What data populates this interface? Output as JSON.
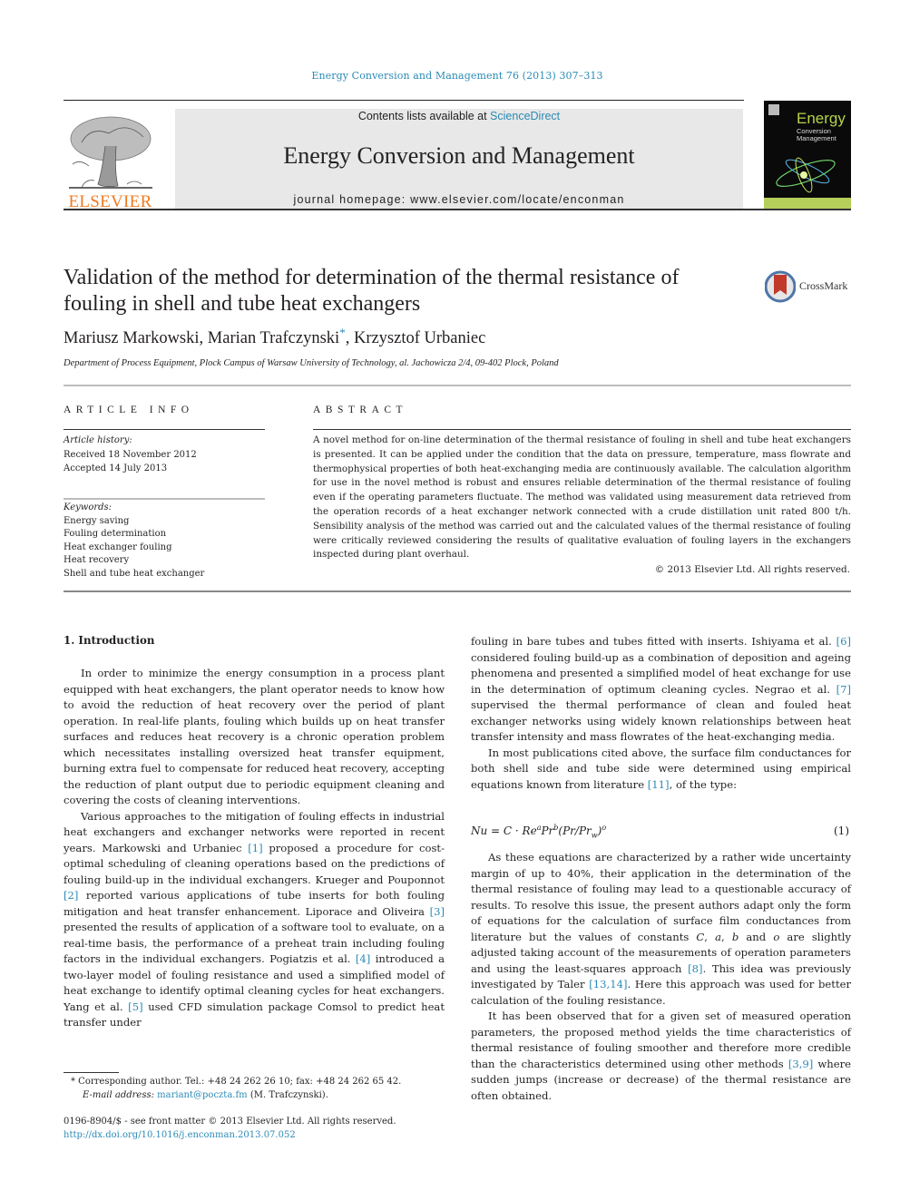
{
  "header": {
    "journal_reference": "Energy Conversion and Management 76 (2013) 307–313",
    "contents_prefix": "Contents lists available at ",
    "contents_link": "ScienceDirect",
    "journal_title": "Energy Conversion and Management",
    "homepage_prefix": "journal homepage: ",
    "homepage_url": "www.elsevier.com/locate/enconman",
    "publisher_logo_text": "ELSEVIER",
    "cover": {
      "title": "Energy",
      "subtitle_line1": "Conversion",
      "subtitle_line2": "Management"
    },
    "colors": {
      "link": "#2a8ab5",
      "elsevier_orange": "#f07b22",
      "masthead_bg": "#e8e8e8"
    }
  },
  "article": {
    "title": "Validation of the method for determination of the thermal resistance of fouling in shell and tube heat exchangers",
    "crossmark_label": "CrossMark",
    "authors": [
      {
        "name": "Mariusz Markowski",
        "corresponding": false
      },
      {
        "name": "Marian Trafczynski",
        "corresponding": true
      },
      {
        "name": "Krzysztof Urbaniec",
        "corresponding": false
      }
    ],
    "author_sep": ", ",
    "corresponding_mark": "*",
    "affiliation": "Department of Process Equipment, Plock Campus of Warsaw University of Technology, al. Jachowicza 2/4, 09-402 Plock, Poland"
  },
  "article_info": {
    "heading": "ARTICLE INFO",
    "history_label": "Article history:",
    "received": "Received 18 November 2012",
    "accepted": "Accepted 14 July 2013",
    "keywords_label": "Keywords:",
    "keywords": [
      "Energy saving",
      "Fouling determination",
      "Heat exchanger fouling",
      "Heat recovery",
      "Shell and tube heat exchanger"
    ]
  },
  "abstract": {
    "heading": "ABSTRACT",
    "text": "A novel method for on-line determination of the thermal resistance of fouling in shell and tube heat exchangers is presented. It can be applied under the condition that the data on pressure, temperature, mass flowrate and thermophysical properties of both heat-exchanging media are continuously available. The calculation algorithm for use in the novel method is robust and ensures reliable determination of the thermal resistance of fouling even if the operating parameters fluctuate. The method was validated using measurement data retrieved from the operation records of a heat exchanger network connected with a crude distillation unit rated 800 t/h. Sensibility analysis of the method was carried out and the calculated values of the thermal resistance of fouling were critically reviewed considering the results of qualitative evaluation of fouling layers in the exchangers inspected during plant overhaul.",
    "copyright": "© 2013 Elsevier Ltd. All rights reserved."
  },
  "body": {
    "section_heading": "1. Introduction",
    "left_paragraphs": [
      [
        {
          "t": "In order to minimize the energy consumption in a process plant equipped with heat exchangers, the plant operator needs to know how to avoid the reduction of heat recovery over the period of plant operation. In real-life plants, fouling which builds up on heat transfer surfaces and reduces heat recovery is a chronic operation problem which necessitates installing oversized heat transfer equipment, burning extra fuel to compensate for reduced heat recovery, accepting the reduction of plant output due to periodic equipment cleaning and covering the costs of cleaning interventions."
        }
      ],
      [
        {
          "t": "Various approaches to the mitigation of fouling effects in industrial heat exchangers and exchanger networks were reported in recent years. Markowski and Urbaniec "
        },
        {
          "ref": "[1]"
        },
        {
          "t": " proposed a procedure for cost-optimal scheduling of cleaning operations based on the predictions of fouling build-up in the individual exchangers. Krueger and Pouponnot "
        },
        {
          "ref": "[2]"
        },
        {
          "t": " reported various applications of tube inserts for both fouling mitigation and heat transfer enhancement. Liporace and Oliveira "
        },
        {
          "ref": "[3]"
        },
        {
          "t": " presented the results of application of a software tool to evaluate, on a real-time basis, the performance of a preheat train including fouling factors in the individual exchangers. Pogiatzis et al. "
        },
        {
          "ref": "[4]"
        },
        {
          "t": " introduced a two-layer model of fouling resistance and used a simplified model of heat exchange to identify optimal cleaning cycles for heat exchangers. Yang et al. "
        },
        {
          "ref": "[5]"
        },
        {
          "t": " used CFD simulation package Comsol to predict heat transfer under"
        }
      ]
    ],
    "right_paragraphs_a": [
      {
        "noindent": true,
        "runs": [
          {
            "t": "fouling in bare tubes and tubes fitted with inserts. Ishiyama et al. "
          },
          {
            "ref": "[6]"
          },
          {
            "t": " considered fouling build-up as a combination of deposition and ageing phenomena and presented a simplified model of heat exchange for use in the determination of optimum cleaning cycles. Negrao et al. "
          },
          {
            "ref": "[7]"
          },
          {
            "t": " supervised the thermal performance of clean and fouled heat exchanger networks using widely known relationships between heat transfer intensity and mass flowrates of the heat-exchanging media."
          }
        ]
      },
      {
        "noindent": false,
        "runs": [
          {
            "t": "In most publications cited above, the surface film conductances for both shell side and tube side were determined using empirical equations known from literature "
          },
          {
            "ref": "[11]"
          },
          {
            "t": ", of the type:"
          }
        ]
      }
    ],
    "equation": {
      "lhs": "Nu",
      "eq": " = C · Re",
      "exp_a": "a",
      "pr": "Pr",
      "exp_b": "b",
      "ratio_open": "(Pr/Pr",
      "sub_w": "w",
      "ratio_close": ")",
      "exp_o": "o",
      "number": "(1)"
    },
    "right_paragraphs_b": [
      {
        "noindent": false,
        "runs": [
          {
            "t": "As these equations are characterized by a rather wide uncertainty margin of up to 40%, their application in the determination of the thermal resistance of fouling may lead to a questionable accuracy of results. To resolve this issue, the present authors adapt only the form of equations for the calculation of surface film conductances from literature but the values of constants "
          },
          {
            "i": "C"
          },
          {
            "t": ", "
          },
          {
            "i": "a"
          },
          {
            "t": ", "
          },
          {
            "i": "b"
          },
          {
            "t": " and "
          },
          {
            "i": "o"
          },
          {
            "t": " are slightly adjusted taking account of the measurements of operation parameters and using the least-squares approach "
          },
          {
            "ref": "[8]"
          },
          {
            "t": ". This idea was previously investigated by Taler "
          },
          {
            "ref": "[13,14]"
          },
          {
            "t": ". Here this approach was used for better calculation of the fouling resistance."
          }
        ]
      },
      {
        "noindent": false,
        "runs": [
          {
            "t": "It has been observed that for a given set of measured operation parameters, the proposed method yields the time characteristics of thermal resistance of fouling smoother and therefore more credible than the characteristics determined using other methods "
          },
          {
            "ref": "[3,9]"
          },
          {
            "t": " where sudden jumps (increase or decrease) of the thermal resistance are often obtained."
          }
        ]
      }
    ]
  },
  "footnote": {
    "mark": "*",
    "line1": " Corresponding author. Tel.: +48 24 262 26 10; fax: +48 24 262 65 42.",
    "email_label": "E-mail address: ",
    "email": "mariant@poczta.fm",
    "email_suffix": " (M. Trafczynski)."
  },
  "issn": {
    "line": "0196-8904/$ - see front matter © 2013 Elsevier Ltd. All rights reserved.",
    "doi": "http://dx.doi.org/10.1016/j.enconman.2013.07.052"
  }
}
